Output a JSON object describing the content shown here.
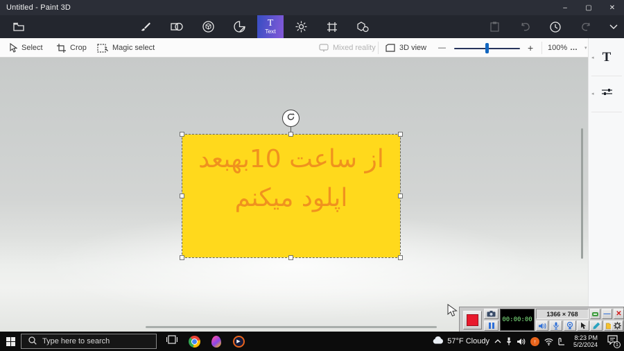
{
  "window": {
    "title": "Untitled - Paint 3D",
    "controls": {
      "minimize": "–",
      "maximize": "▢",
      "close": "✕"
    }
  },
  "toolbar": {
    "text_tool": {
      "glyph": "T",
      "label": "Text"
    }
  },
  "ribbon": {
    "select": "Select",
    "crop": "Crop",
    "magic_select": "Magic select",
    "mixed_reality": "Mixed reality",
    "view_3d": "3D view",
    "zoom_out": "—",
    "zoom_in": "+",
    "zoom_level": "100%",
    "more": "…"
  },
  "sidebar": {
    "text_glyph": "T"
  },
  "canvas": {
    "note": {
      "line1": "از ساعت 10بهبعد",
      "line2": "اپلود میکنم",
      "box_color": "#ffd91c",
      "text_color": "#f0921e"
    }
  },
  "recorder": {
    "timer": "00:00:00",
    "resolution": "1366 × 768",
    "minimize": "—",
    "close": "✕"
  },
  "taskbar": {
    "search_placeholder": "Type here to search",
    "weather": "57°F  Cloudy",
    "time": "8:23 PM",
    "date": "5/2/2024",
    "notification_count": "1",
    "play_glyph": "▶"
  }
}
